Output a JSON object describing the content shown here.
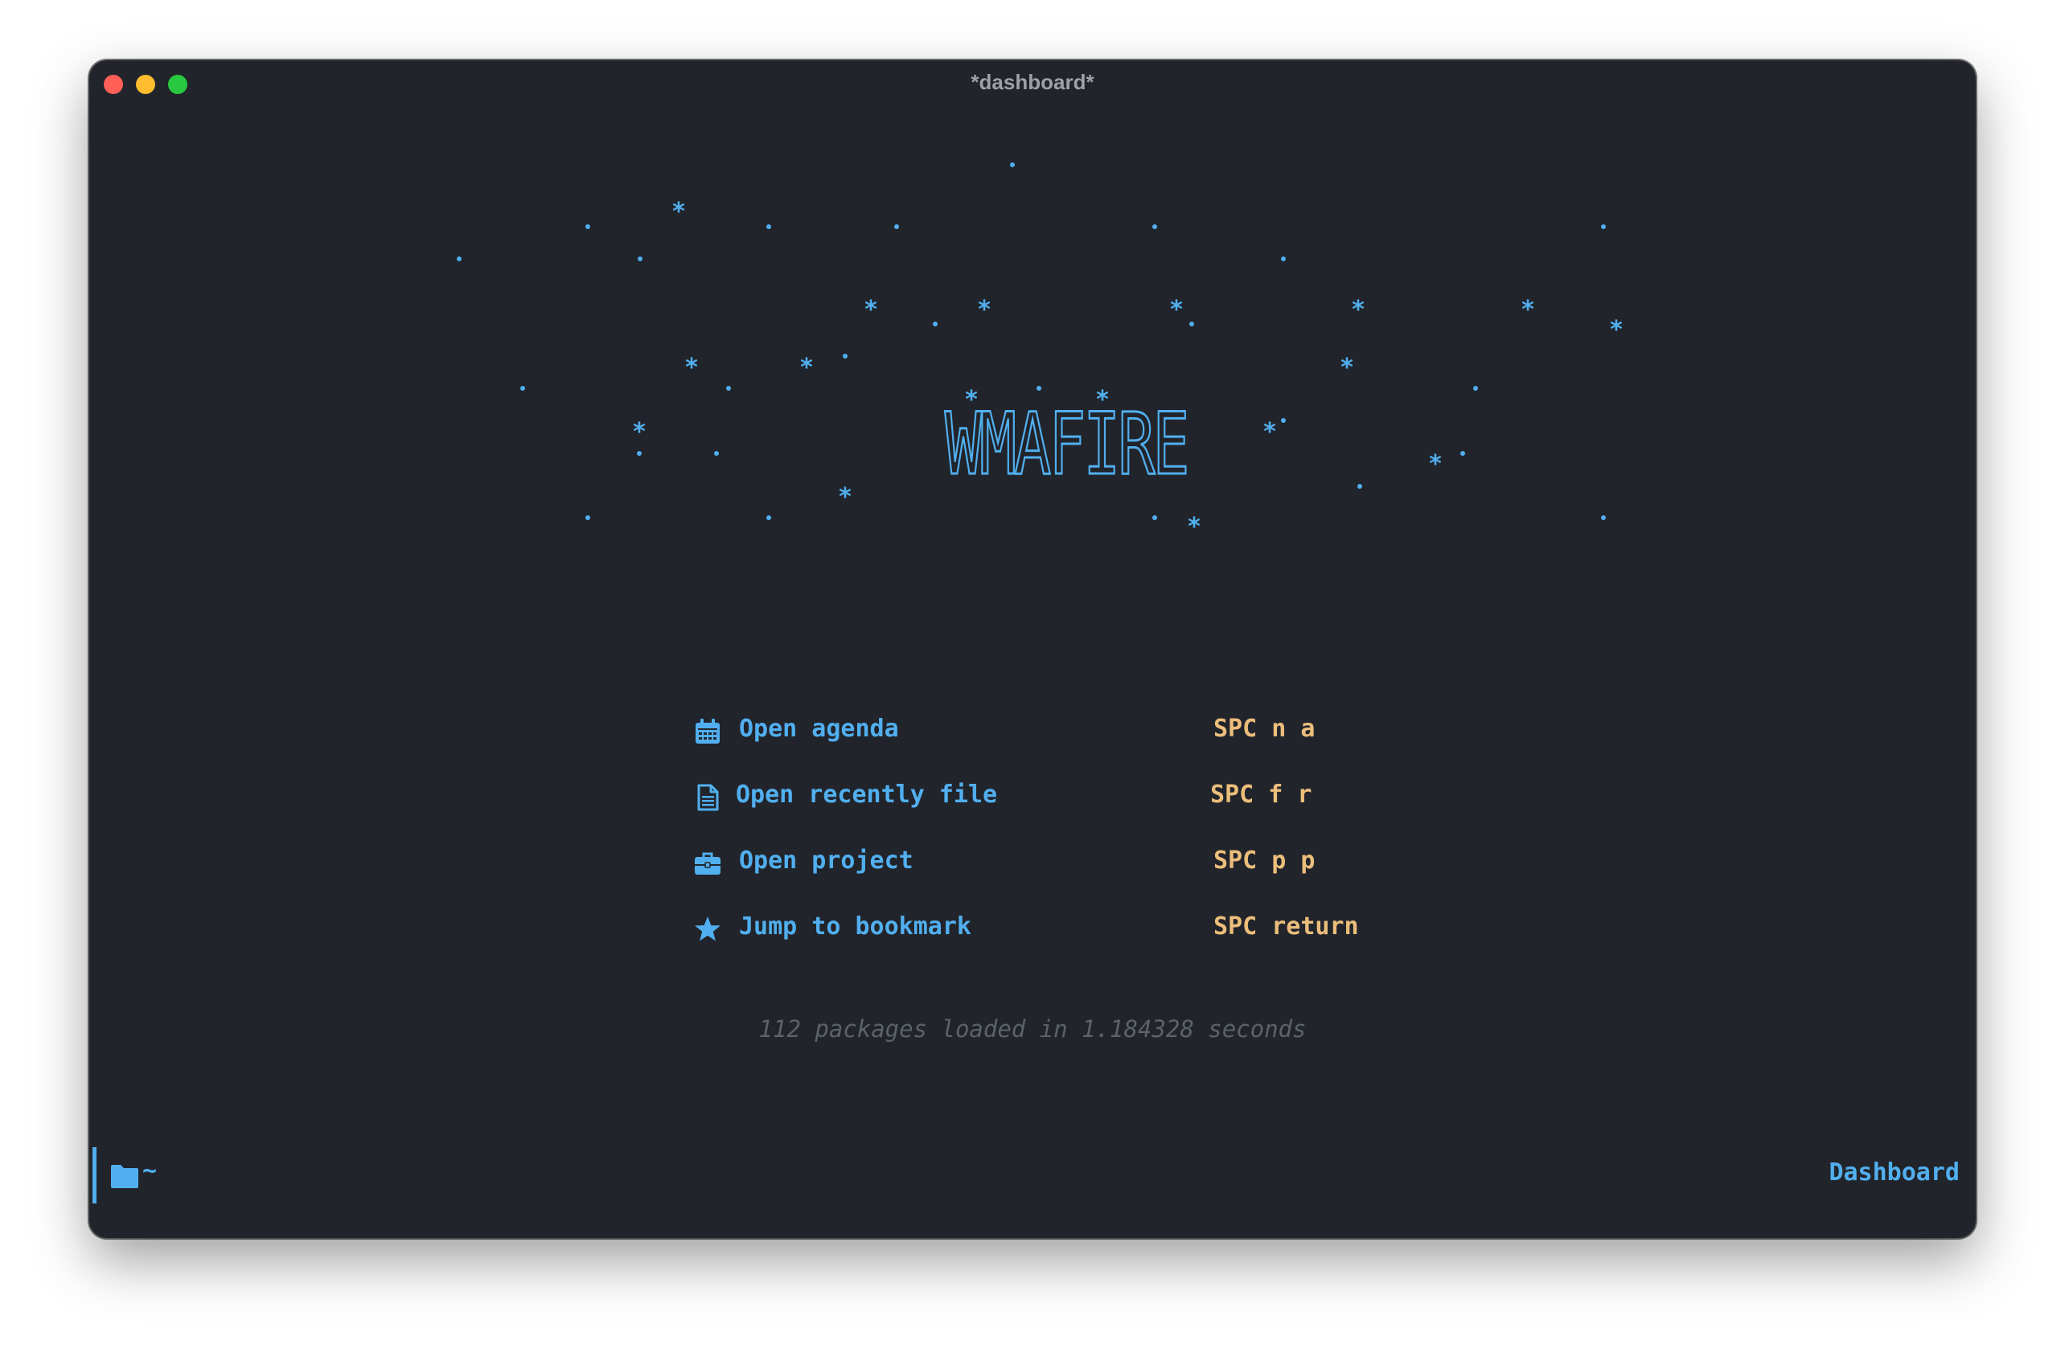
{
  "window": {
    "title": "*dashboard*"
  },
  "banner": {
    "logo_text": "WMAFIRE",
    "star_color": "#51afef",
    "star_glyphs": [
      "*",
      "."
    ]
  },
  "menu": {
    "items": [
      {
        "label": "Open agenda",
        "shortcut": "SPC n a",
        "icon": "calendar-icon"
      },
      {
        "label": "Open recently file",
        "shortcut": "SPC f r",
        "icon": "file-icon"
      },
      {
        "label": "Open project",
        "shortcut": "SPC p p",
        "icon": "briefcase-icon"
      },
      {
        "label": "Jump to bookmark",
        "shortcut": "SPC return",
        "icon": "star-icon"
      }
    ]
  },
  "footer": {
    "loaded_text": "112 packages loaded in 1.184328 seconds"
  },
  "modeline": {
    "directory": "~",
    "directory_icon": "folder-icon",
    "mode_name": "Dashboard"
  },
  "colors": {
    "background": "#21242b",
    "accent": "#51afef",
    "keybinding": "#ecbe7b",
    "comment": "#5b6268",
    "title": "#9da1a8"
  }
}
